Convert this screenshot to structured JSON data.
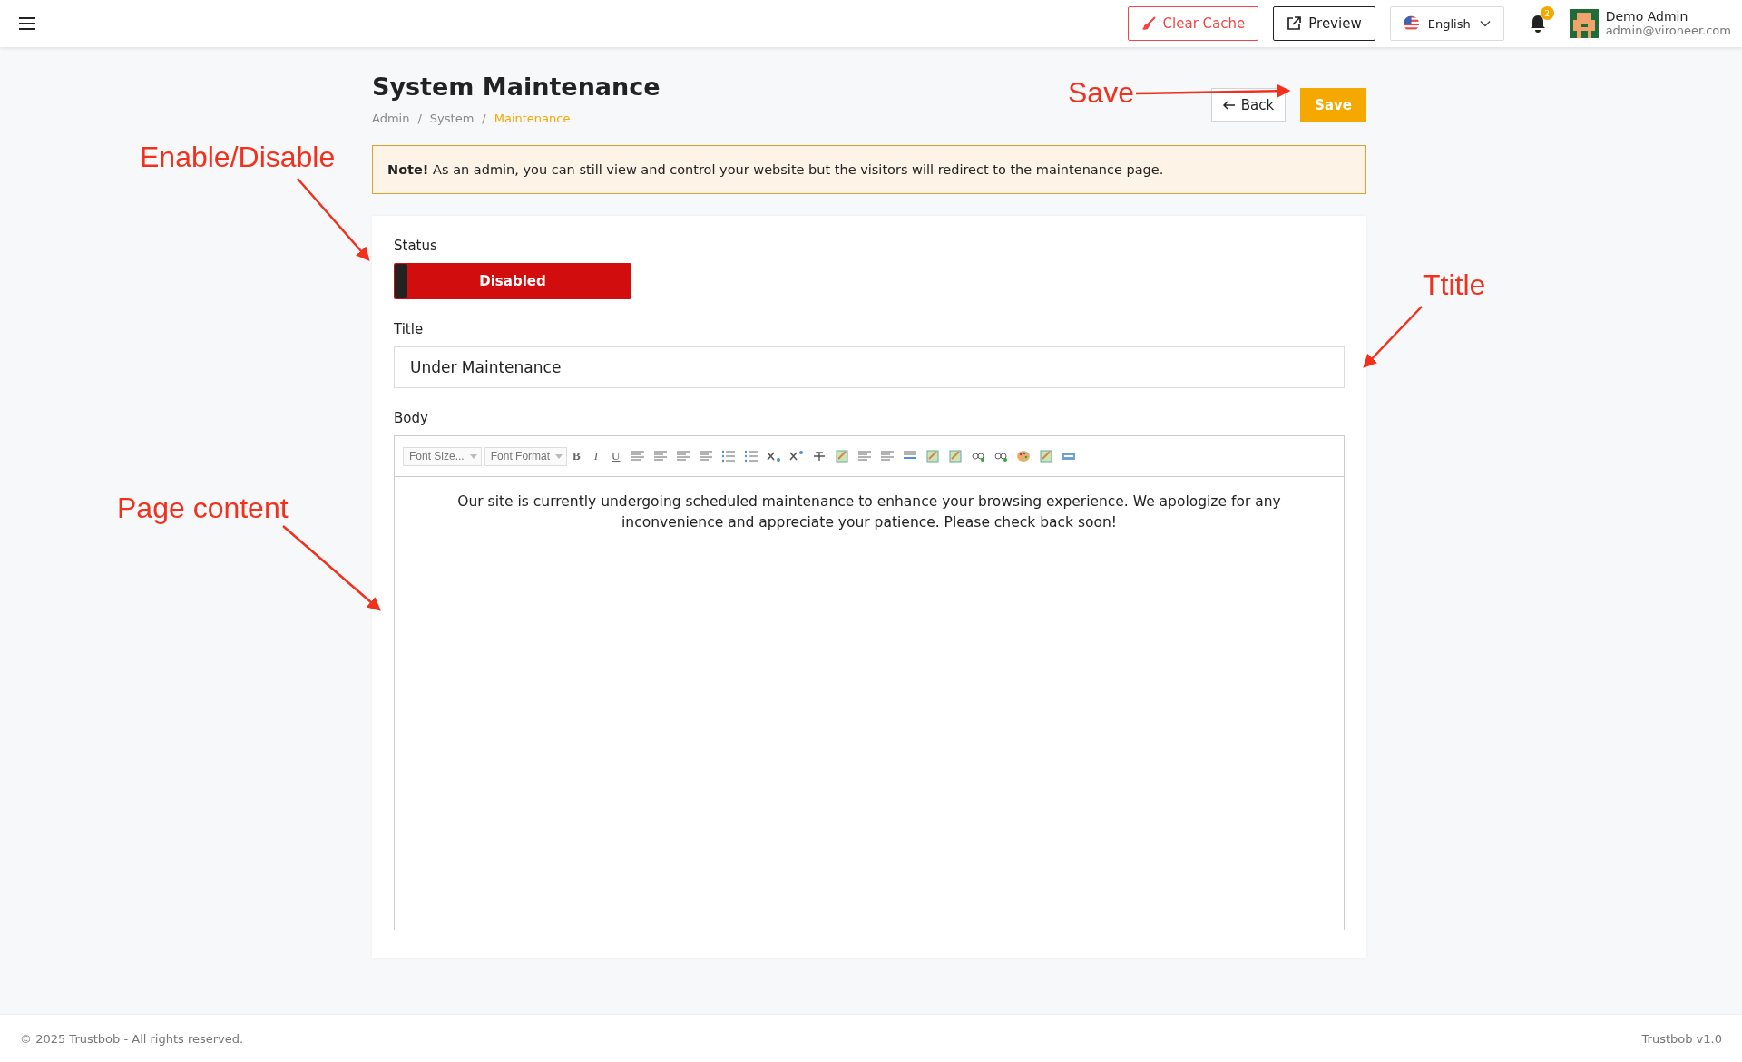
{
  "topbar": {
    "clear_cache": "Clear Cache",
    "preview": "Preview",
    "language": "English",
    "notifications": "2",
    "user": {
      "name": "Demo Admin",
      "email": "admin@vironeer.com"
    }
  },
  "header": {
    "title": "System Maintenance",
    "breadcrumb": [
      {
        "label": "Admin",
        "selected": false
      },
      {
        "separator": "/",
        "label": "System",
        "selected": false
      },
      {
        "separator": "/",
        "label": "Maintenance",
        "selected": true
      }
    ],
    "back": "Back",
    "save": "Save"
  },
  "note": "**Note!** As an admin, you can still view and control your website but the visitors will redirect to the maintenance page.",
  "form": {
    "status": {
      "label": "Status",
      "text": "Disabled",
      "on": false
    },
    "title": {
      "label": "Title",
      "value": "Under Maintenance"
    },
    "body": {
      "label": "Body",
      "selects": [
        "Font Size...",
        "Font Format"
      ],
      "text_buttons": [
        {
          "kind": "bold",
          "label": "B"
        },
        {
          "kind": "italic",
          "label": "I"
        },
        {
          "kind": "underline",
          "label": "U"
        }
      ],
      "content": "Our site is currently undergoing scheduled maintenance to enhance your browsing experience. We apologize for any inconvenience and appreciate your patience. Please check back soon!"
    }
  },
  "annotations": [
    {
      "text": "Enable/Disable"
    },
    {
      "text": "Save"
    },
    {
      "text": "Ttitle"
    },
    {
      "text": "Page content"
    }
  ],
  "footer": {
    "copyright": "© 2025 Trustbob - All rights reserved.",
    "version": "Trustbob v1.0"
  }
}
